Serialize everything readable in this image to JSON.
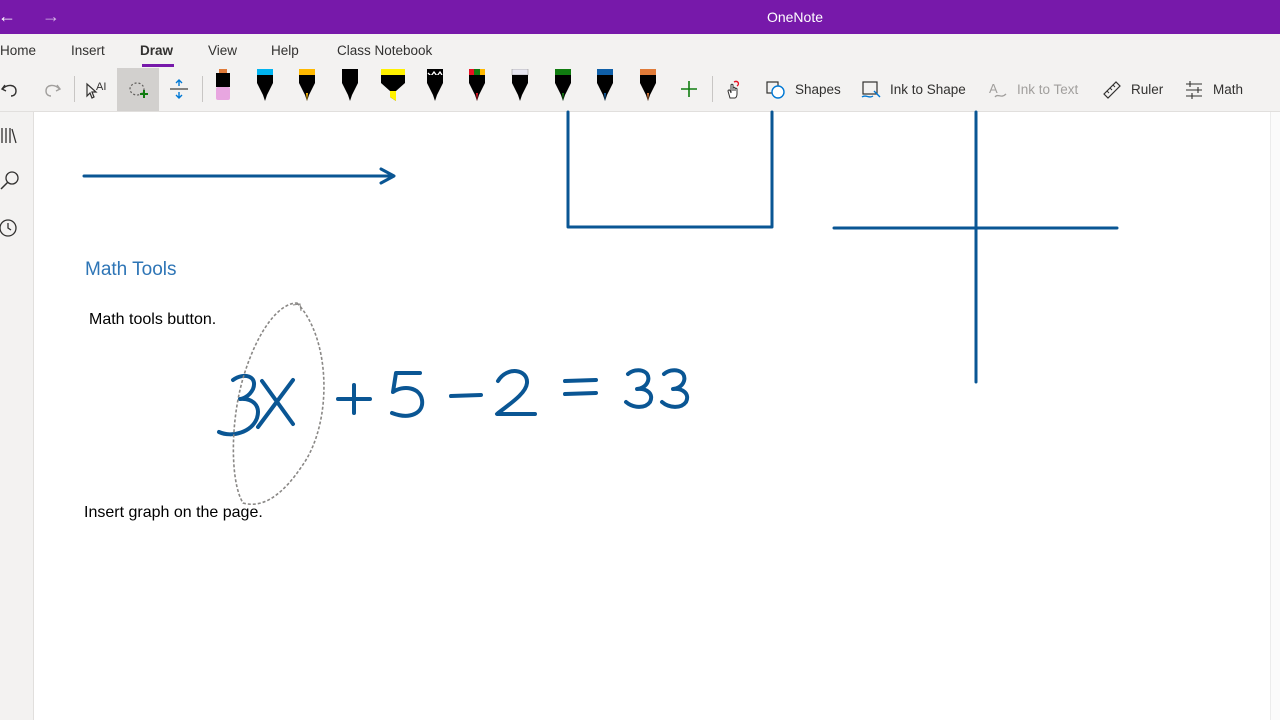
{
  "app": {
    "title": "OneNote"
  },
  "nav": {
    "back": "←",
    "forward": "→"
  },
  "tabs": [
    {
      "label": "Home"
    },
    {
      "label": "Insert"
    },
    {
      "label": "Draw",
      "active": true
    },
    {
      "label": "View"
    },
    {
      "label": "Help"
    },
    {
      "label": "Class Notebook"
    }
  ],
  "ribbon": {
    "shapes_label": "Shapes",
    "ink_to_shape_label": "Ink to Shape",
    "ink_to_text_label": "Ink to Text",
    "ruler_label": "Ruler",
    "math_label": "Math",
    "pens": [
      {
        "color": "#000000",
        "cap": "#f5a3c7",
        "icon": "pen-icon"
      },
      {
        "color": "#000000",
        "cap": "#00b4f0",
        "icon": "pen-icon"
      },
      {
        "color": "#000000",
        "cap": "#ffb900",
        "icon": "pen-icon"
      },
      {
        "color": "#000000",
        "cap": "#000000",
        "icon": "pen-icon"
      },
      {
        "color": "#fff100",
        "cap": "#fff100",
        "icon": "highlighter-icon"
      },
      {
        "color": "#000000",
        "cap": "#000000",
        "icon": "galaxy-pen-icon"
      },
      {
        "color": "#000000",
        "cap": "#e81123",
        "icon": "pen-icon"
      },
      {
        "color": "#000000",
        "cap": "#e6e6f0",
        "icon": "pen-icon"
      },
      {
        "color": "#000000",
        "cap": "#107c10",
        "icon": "pen-icon"
      },
      {
        "color": "#000000",
        "cap": "#0f5fa8",
        "icon": "pen-icon"
      },
      {
        "color": "#000000",
        "cap": "#e07b39",
        "icon": "pen-icon"
      }
    ],
    "accent_color": "#7719aa",
    "ink_color": "#0a5694"
  },
  "page": {
    "heading": "Math Tools",
    "note1": "Math tools button.",
    "note2": "Insert  graph on the page.",
    "equation_ink": "3x + 5 - 2 = 33"
  }
}
